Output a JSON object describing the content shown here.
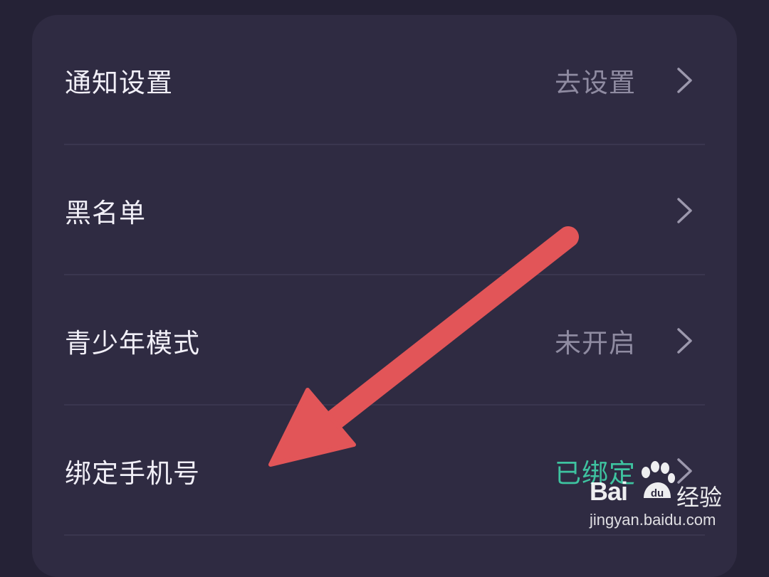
{
  "settings": {
    "items": [
      {
        "label": "通知设置",
        "value": "去设置",
        "value_color": "#8f8ba1"
      },
      {
        "label": "黑名单",
        "value": ""
      },
      {
        "label": "青少年模式",
        "value": "未开启",
        "value_color": "#8f8ba1"
      },
      {
        "label": "绑定手机号",
        "value": "已绑定",
        "value_color": "#3ec3a0"
      }
    ]
  },
  "annotation": {
    "arrow_color": "#e25558"
  },
  "watermark": {
    "brand": "Bai du 经验",
    "url": "jingyan.baidu.com"
  },
  "colors": {
    "page_bg": "#252236",
    "card_bg": "#2f2b42",
    "divider": "#3a364f",
    "label": "#f1eff7",
    "secondary": "#8f8ba1",
    "accent": "#3ec3a0"
  },
  "icons": {
    "chevron": "chevron-right-icon",
    "paw": "paw-icon"
  }
}
